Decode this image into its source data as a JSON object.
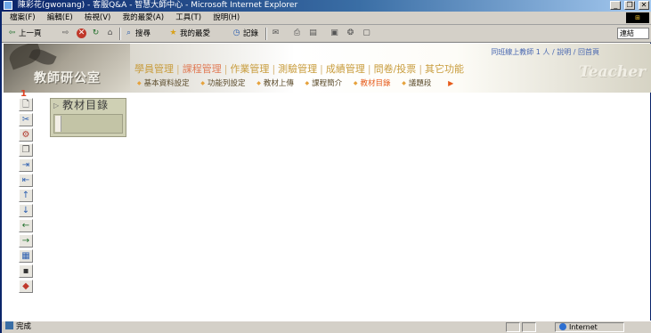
{
  "window": {
    "title": "陳彩花(gwonang) - 客服Q&A - 智慧大師中心 - Microsoft Internet Explorer",
    "controls": [
      "_",
      "❐",
      "✕"
    ]
  },
  "menubar": {
    "items": [
      "檔案(F)",
      "編輯(E)",
      "檢視(V)",
      "我的最愛(A)",
      "工具(T)",
      "說明(H)"
    ]
  },
  "toolbar": {
    "back": "上一頁",
    "search": "搜尋",
    "favorites": "我的最愛",
    "history": "記錄",
    "links": "連結"
  },
  "header": {
    "logo_text": "教師研公室",
    "online_status": "同班線上教師 1 人 / 說明 / 回首頁",
    "main_nav": [
      {
        "label": "學員管理",
        "active": false
      },
      {
        "label": "課程管理",
        "active": true
      },
      {
        "label": "作業管理",
        "active": false
      },
      {
        "label": "測驗管理",
        "active": false
      },
      {
        "label": "成績管理",
        "active": false
      },
      {
        "label": "問卷/投票",
        "active": false
      },
      {
        "label": "其它功能",
        "active": false
      }
    ],
    "sub_nav": [
      {
        "label": "基本資料設定",
        "active": false
      },
      {
        "label": "功能列設定",
        "active": false
      },
      {
        "label": "教材上傳",
        "active": false
      },
      {
        "label": "課程簡介",
        "active": false
      },
      {
        "label": "教材目錄",
        "active": true
      },
      {
        "label": "議題段",
        "active": false
      }
    ],
    "watermark": "Teacher"
  },
  "side_toolbar": {
    "marker": "1",
    "icons": [
      "new-page-icon",
      "cut-icon",
      "tool-icon",
      "copy-icon",
      "indent-icon",
      "outdent-icon",
      "move-up-icon",
      "move-down-icon",
      "move-left-icon",
      "move-right-icon",
      "properties-icon",
      "save-icon",
      "delete-icon"
    ]
  },
  "panel": {
    "title": "教材目錄"
  },
  "statusbar": {
    "status": "完成",
    "zone": "Internet"
  }
}
